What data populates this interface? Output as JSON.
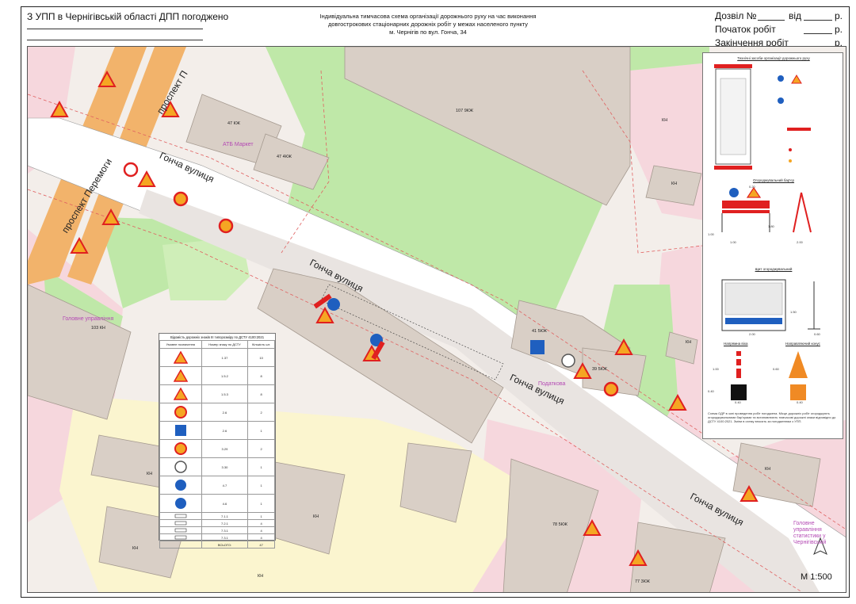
{
  "header": {
    "approval": "З УПП в Чернігівській області ДПП погоджено",
    "title_lines": [
      "Індивідуальна тимчасова схема організації дорожнього руху на час виконання",
      "довгострокових стаціонарних дорожніх робіт у межах населеного пункту",
      "м. Чернігів по вул. Гонча, 34"
    ],
    "permit_label": "Дозвіл №",
    "permit_from": "від",
    "start_label": "Початок робіт",
    "end_label": "Закінчення робіт",
    "year_suffix": "р."
  },
  "map": {
    "streets": {
      "goncha": "Гонча вулиця",
      "peremohy": "проспект Перемоги",
      "peremohy_short": "проспект П"
    },
    "buildings": [
      "47 КЖ",
      "47 4КЖ",
      "107 9КЖ",
      "41 5КЖ",
      "39 5КЖ",
      "103 КН",
      "78 5КЖ",
      "77 3КЖ",
      "КН",
      "КН",
      "КН",
      "КН",
      "КН",
      "КН",
      "КН",
      "КН"
    ],
    "poi": [
      "АТБ Маркет",
      "Головне управління",
      "Головне управління статистики у Чернігівській",
      "Податкова"
    ],
    "scale": "М 1:500"
  },
  "legend": {
    "title": "Відомість дорожніх знаків III типорозміру по ДСТУ 4100:2021",
    "columns": [
      "Умовне позначення",
      "Номер знаку по ДСТУ",
      "Кількість шт."
    ],
    "rows": [
      {
        "code": "1.37",
        "count": "10"
      },
      {
        "code": "1.5.2",
        "count": "8"
      },
      {
        "code": "1.5.3",
        "count": "8"
      },
      {
        "code": "2.6",
        "count": "2"
      },
      {
        "code": "2.6",
        "count": "1"
      },
      {
        "code": "3.29",
        "count": "2"
      },
      {
        "code": "3.30",
        "count": "1"
      },
      {
        "code": "4.7",
        "count": "1"
      },
      {
        "code": "4.6",
        "count": "1"
      },
      {
        "code": "7.1.1",
        "count": "1"
      },
      {
        "code": "7.2.1",
        "count": "4"
      },
      {
        "code": "7.3.1",
        "count": "4"
      },
      {
        "code": "7.3.1",
        "count": "4"
      }
    ],
    "total_label": "ВСЬОГО:",
    "total": "47"
  },
  "panel": {
    "t1": "Технічні засоби організації дорожнього руху",
    "t2": "Огороджувальний бар'єр",
    "t3": "Щит огороджувальний",
    "t4": "Напрямна віха",
    "t5": "Направляючий конус",
    "note": "Схема ОДР в зоні проведення робіт погоджена. Місце дорожніх робіт огороджують огороджувальними бар'єрами та встановлюють тимчасові дорожні знаки відповідно до ДСТУ 4100:2021. Зміни в схему вносять за погодженням з УПП.",
    "dims": [
      "1.00",
      "1.00",
      "1.80",
      "0.20",
      "2.00",
      "0.60",
      "2.00",
      "1.50",
      "0.40",
      "1.00",
      "0.40",
      "0.40",
      "0.60"
    ]
  },
  "colors": {
    "sign_yellow": "#f5a623",
    "sign_red": "#e02020",
    "sign_blue": "#1f5fbf",
    "road_orange": "#f2b36b",
    "pink_zone": "#f6d7dd",
    "green": "#bfe8a8",
    "building": "#d9cfc6",
    "cream": "#fbf5cf"
  }
}
